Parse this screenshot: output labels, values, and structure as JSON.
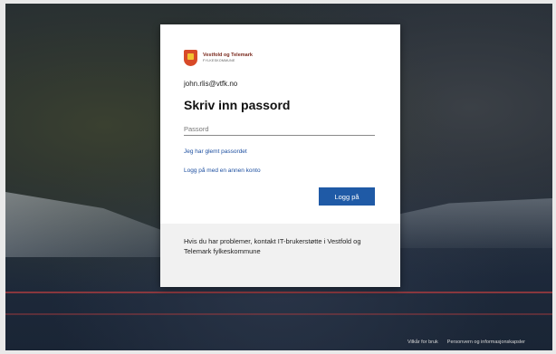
{
  "org": {
    "name": "Vestfold og Telemark",
    "subtitle": "FYLKESKOMMUNE"
  },
  "signin": {
    "email": "john.rlis@vtfk.no",
    "title": "Skriv inn passord",
    "password_placeholder": "Passord",
    "forgot_link": "Jeg har glemt passordet",
    "other_account_link": "Logg på med en annen konto",
    "submit_label": "Logg på"
  },
  "footer": {
    "help_text": "Hvis du har problemer, kontakt IT-brukerstøtte i Vestfold og Telemark fylkeskommune"
  },
  "page_links": {
    "terms": "Vilkår for bruk",
    "privacy": "Personvern og informasjonskapsler"
  },
  "colors": {
    "accent": "#1f5aa6",
    "link": "#1d4fa0",
    "crest": "#d84a28"
  }
}
